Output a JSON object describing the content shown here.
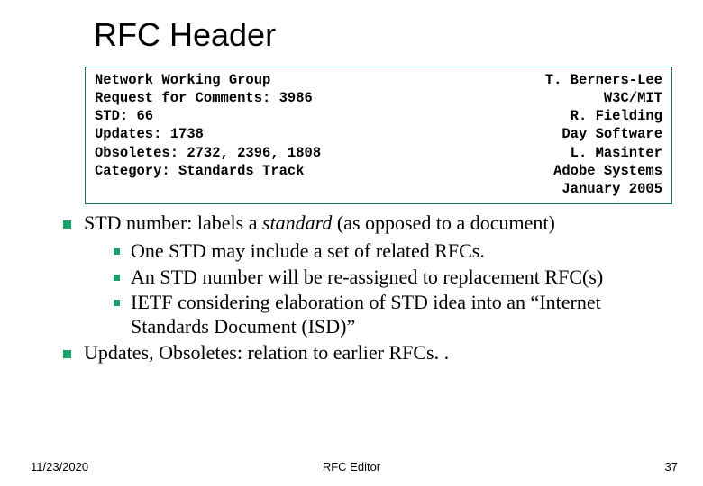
{
  "title": "RFC Header",
  "header_box": {
    "left": [
      "Network Working Group",
      "Request for Comments: 3986",
      "STD: 66",
      "Updates: 1738",
      "Obsoletes: 2732, 2396, 1808",
      "Category: Standards Track"
    ],
    "right": [
      "T. Berners-Lee",
      "W3C/MIT",
      "R. Fielding",
      "Day Software",
      "L. Masinter",
      "Adobe Systems",
      "January 2005"
    ]
  },
  "bullets": [
    {
      "level": 1,
      "html": "STD number: labels a <span class=\"italic\">standard</span> (as opposed to a document)"
    },
    {
      "level": 2,
      "text": "One STD may include a set of related RFCs."
    },
    {
      "level": 2,
      "text": "An STD number will be re-assigned to replacement RFC(s)"
    },
    {
      "level": 2,
      "text": "IETF considering elaboration of STD idea into an “Internet Standards Document (ISD)”"
    },
    {
      "level": 1,
      "text": "Updates, Obsoletes: relation to earlier RFCs. ."
    }
  ],
  "footer": {
    "date": "11/23/2020",
    "center": "RFC Editor",
    "page": "37"
  }
}
